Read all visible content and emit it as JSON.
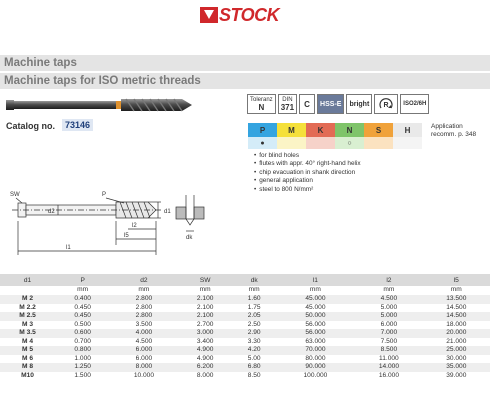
{
  "brand": {
    "name": "STOCK",
    "color": "#d0282b"
  },
  "bands": {
    "title1": "Machine taps",
    "title2": "Machine taps for ISO metric threads"
  },
  "catalog": {
    "label": "Catalog no.",
    "value": "73146"
  },
  "standards": {
    "tolerance": {
      "top": "Toleranz",
      "main": "N"
    },
    "din": {
      "top": "DIN",
      "main": "371"
    },
    "c": "C",
    "hss": "HSS-E",
    "finish": "bright",
    "rotation": "R",
    "iso": "ISO2/6H"
  },
  "materials": {
    "heads": [
      "P",
      "M",
      "K",
      "N",
      "S",
      "H"
    ],
    "colors": [
      "#34a4e0",
      "#f5e03a",
      "#e26b55",
      "#7fc46a",
      "#f0a23a",
      "#b8b8b8"
    ],
    "symbols": [
      "●",
      "",
      "",
      "○",
      "",
      ""
    ],
    "note": "Application recomm. p. 348"
  },
  "features": [
    "for blind holes",
    "flutes with appr. 40° right-hand helix",
    "chip evacuation in shank direction",
    "general application",
    "steel to 800 N/mm²"
  ],
  "drawing_labels": {
    "sw": "SW",
    "p": "P",
    "d2": "d2",
    "d1": "d1",
    "l2": "l2",
    "l5": "l5",
    "l1": "l1",
    "dk": "dk"
  },
  "table": {
    "headers": [
      "d1",
      "P",
      "d2",
      "SW",
      "dk",
      "l1",
      "l2",
      "l5"
    ],
    "units": [
      "",
      "mm",
      "mm",
      "mm",
      "mm",
      "mm",
      "mm",
      "mm"
    ],
    "rows": [
      [
        "M 2",
        "0.400",
        "2.800",
        "2.100",
        "1.60",
        "45.000",
        "4.500",
        "13.500"
      ],
      [
        "M 2.2",
        "0.450",
        "2.800",
        "2.100",
        "1.75",
        "45.000",
        "5.000",
        "14.500"
      ],
      [
        "M 2.5",
        "0.450",
        "2.800",
        "2.100",
        "2.05",
        "50.000",
        "5.000",
        "14.500"
      ],
      [
        "M 3",
        "0.500",
        "3.500",
        "2.700",
        "2.50",
        "56.000",
        "6.000",
        "18.000"
      ],
      [
        "M 3.5",
        "0.600",
        "4.000",
        "3.000",
        "2.90",
        "56.000",
        "7.000",
        "20.000"
      ],
      [
        "M 4",
        "0.700",
        "4.500",
        "3.400",
        "3.30",
        "63.000",
        "7.500",
        "21.000"
      ],
      [
        "M 5",
        "0.800",
        "6.000",
        "4.900",
        "4.20",
        "70.000",
        "8.500",
        "25.000"
      ],
      [
        "M 6",
        "1.000",
        "6.000",
        "4.900",
        "5.00",
        "80.000",
        "11.000",
        "30.000"
      ],
      [
        "M 8",
        "1.250",
        "8.000",
        "6.200",
        "6.80",
        "90.000",
        "14.000",
        "35.000"
      ],
      [
        "M10",
        "1.500",
        "10.000",
        "8.000",
        "8.50",
        "100.000",
        "16.000",
        "39.000"
      ]
    ]
  }
}
